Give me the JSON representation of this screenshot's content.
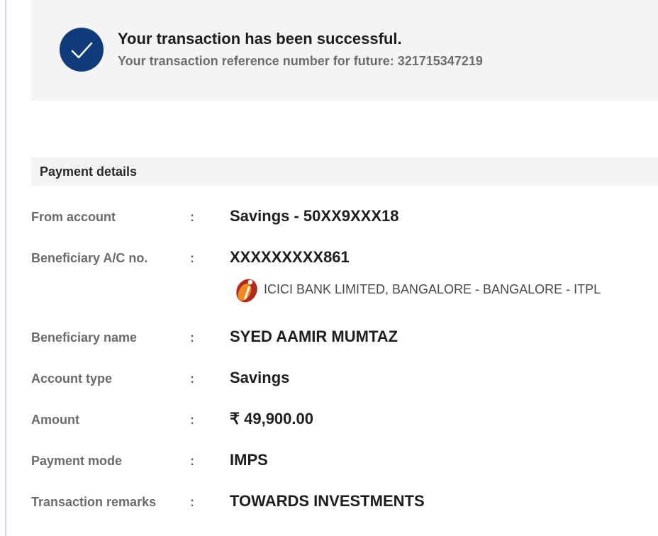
{
  "banner": {
    "title": "Your transaction has been successful.",
    "reference_text": "Your transaction reference number for future: 321715347219",
    "icon": "check-circle-icon",
    "icon_color": "#0f3b7a"
  },
  "payment_details": {
    "title": "Payment details",
    "separator": ":",
    "rows": [
      {
        "label": "From account",
        "value": "Savings - 50XX9XXX18"
      },
      {
        "label": "Beneficiary A/C no.",
        "value": "XXXXXXXXX861"
      },
      {
        "label": "Beneficiary name",
        "value": "SYED AAMIR MUMTAZ"
      },
      {
        "label": "Account type",
        "value": "Savings"
      },
      {
        "label": "Amount",
        "value": "₹ 49,900.00"
      },
      {
        "label": "Payment mode",
        "value": "IMPS"
      },
      {
        "label": "Transaction remarks",
        "value": "TOWARDS INVESTMENTS"
      }
    ],
    "bank": {
      "name": "ICICI BANK LIMITED, BANGALORE - BANGALORE - ITPL",
      "logo_icon": "icici-bank-logo",
      "logo_colors": [
        "#b02a1f",
        "#f28a1e"
      ]
    }
  }
}
